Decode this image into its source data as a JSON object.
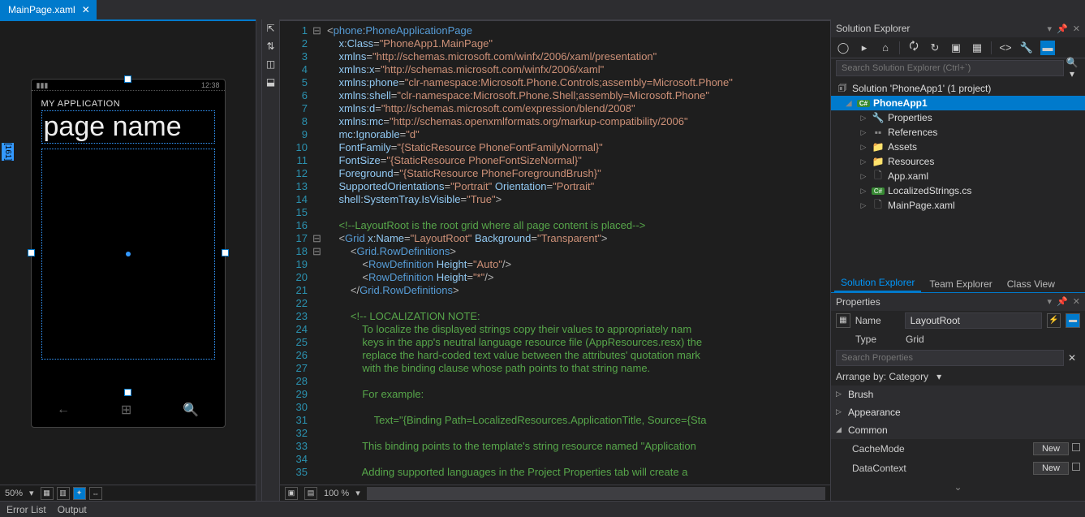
{
  "tab": {
    "title": "MainPage.xaml",
    "close": "✕"
  },
  "designer": {
    "phone_time": "12:38",
    "app_title": "MY APPLICATION",
    "page_title": "page name",
    "zoom": "50%",
    "ruler_tag": "[161]"
  },
  "editor": {
    "zoom": "100 %",
    "lines": [
      {
        "n": 1,
        "fold": "⊟",
        "html": "<span class='punct'>&lt;</span><span class='xml-el'>phone</span><span class='punct'>:</span><span class='xml-el'>PhoneApplicationPage</span>"
      },
      {
        "n": 2,
        "html": "    <span class='xml-attr'>x</span><span class='punct'>:</span><span class='xml-attr'>Class</span><span class='punct'>=</span><span class='str'>\"PhoneApp1.MainPage\"</span>"
      },
      {
        "n": 3,
        "html": "    <span class='xml-attr'>xmlns</span><span class='punct'>=</span><span class='str'>\"http://schemas.microsoft.com/winfx/2006/xaml/presentation\"</span>"
      },
      {
        "n": 4,
        "html": "    <span class='xml-attr'>xmlns</span><span class='punct'>:</span><span class='xml-attr'>x</span><span class='punct'>=</span><span class='str'>\"http://schemas.microsoft.com/winfx/2006/xaml\"</span>"
      },
      {
        "n": 5,
        "html": "    <span class='xml-attr'>xmlns</span><span class='punct'>:</span><span class='xml-attr'>phone</span><span class='punct'>=</span><span class='str'>\"clr-namespace:Microsoft.Phone.Controls;assembly=Microsoft.Phone\"</span>"
      },
      {
        "n": 6,
        "html": "    <span class='xml-attr'>xmlns</span><span class='punct'>:</span><span class='xml-attr'>shell</span><span class='punct'>=</span><span class='str'>\"clr-namespace:Microsoft.Phone.Shell;assembly=Microsoft.Phone\"</span>"
      },
      {
        "n": 7,
        "html": "    <span class='xml-attr'>xmlns</span><span class='punct'>:</span><span class='xml-attr'>d</span><span class='punct'>=</span><span class='str'>\"http://schemas.microsoft.com/expression/blend/2008\"</span>"
      },
      {
        "n": 8,
        "html": "    <span class='xml-attr'>xmlns</span><span class='punct'>:</span><span class='xml-attr'>mc</span><span class='punct'>=</span><span class='str'>\"http://schemas.openxmlformats.org/markup-compatibility/2006\"</span>"
      },
      {
        "n": 9,
        "html": "    <span class='xml-attr'>mc</span><span class='punct'>:</span><span class='xml-attr'>Ignorable</span><span class='punct'>=</span><span class='str'>\"d\"</span>"
      },
      {
        "n": 10,
        "html": "    <span class='xml-attr'>FontFamily</span><span class='punct'>=</span><span class='str'>\"{StaticResource PhoneFontFamilyNormal}\"</span>"
      },
      {
        "n": 11,
        "html": "    <span class='xml-attr'>FontSize</span><span class='punct'>=</span><span class='str'>\"{StaticResource PhoneFontSizeNormal}\"</span>"
      },
      {
        "n": 12,
        "html": "    <span class='xml-attr'>Foreground</span><span class='punct'>=</span><span class='str'>\"{StaticResource PhoneForegroundBrush}\"</span>"
      },
      {
        "n": 13,
        "html": "    <span class='xml-attr'>SupportedOrientations</span><span class='punct'>=</span><span class='str'>\"Portrait\"</span> <span class='xml-attr'>Orientation</span><span class='punct'>=</span><span class='str'>\"Portrait\"</span>"
      },
      {
        "n": 14,
        "html": "    <span class='xml-attr'>shell</span><span class='punct'>:</span><span class='xml-attr'>SystemTray.IsVisible</span><span class='punct'>=</span><span class='str'>\"True\"</span><span class='punct'>&gt;</span>"
      },
      {
        "n": 15,
        "html": ""
      },
      {
        "n": 16,
        "html": "    <span class='cmt'>&lt;!--LayoutRoot is the root grid where all page content is placed--&gt;</span>"
      },
      {
        "n": 17,
        "fold": "⊟",
        "html": "    <span class='punct'>&lt;</span><span class='xml-el'>Grid</span> <span class='xml-attr'>x</span><span class='punct'>:</span><span class='xml-attr'>Name</span><span class='punct'>=</span><span class='str'>\"LayoutRoot\"</span> <span class='xml-attr'>Background</span><span class='punct'>=</span><span class='str'>\"Transparent\"</span><span class='punct'>&gt;</span>"
      },
      {
        "n": 18,
        "fold": "⊟",
        "html": "        <span class='punct'>&lt;</span><span class='xml-el'>Grid.RowDefinitions</span><span class='punct'>&gt;</span>"
      },
      {
        "n": 19,
        "html": "            <span class='punct'>&lt;</span><span class='xml-el'>RowDefinition</span> <span class='xml-attr'>Height</span><span class='punct'>=</span><span class='str'>\"Auto\"</span><span class='punct'>/&gt;</span>"
      },
      {
        "n": 20,
        "html": "            <span class='punct'>&lt;</span><span class='xml-el'>RowDefinition</span> <span class='xml-attr'>Height</span><span class='punct'>=</span><span class='str'>\"*\"</span><span class='punct'>/&gt;</span>"
      },
      {
        "n": 21,
        "html": "        <span class='punct'>&lt;/</span><span class='xml-el'>Grid.RowDefinitions</span><span class='punct'>&gt;</span>"
      },
      {
        "n": 22,
        "html": ""
      },
      {
        "n": 23,
        "html": "        <span class='cmt'>&lt;!-- LOCALIZATION NOTE:</span>"
      },
      {
        "n": 24,
        "html": "            <span class='cmt'>To localize the displayed strings copy their values to appropriately nam</span>"
      },
      {
        "n": 25,
        "html": "            <span class='cmt'>keys in the app's neutral language resource file (AppResources.resx) the</span>"
      },
      {
        "n": 26,
        "html": "            <span class='cmt'>replace the hard-coded text value between the attributes' quotation mark</span>"
      },
      {
        "n": 27,
        "html": "            <span class='cmt'>with the binding clause whose path points to that string name.</span>"
      },
      {
        "n": 28,
        "html": ""
      },
      {
        "n": 29,
        "html": "            <span class='cmt'>For example:</span>"
      },
      {
        "n": 30,
        "html": ""
      },
      {
        "n": 31,
        "html": "                <span class='cmt'>Text=\"{Binding Path=LocalizedResources.ApplicationTitle, Source={Sta</span>"
      },
      {
        "n": 32,
        "html": ""
      },
      {
        "n": 33,
        "html": "            <span class='cmt'>This binding points to the template's string resource named \"Application</span>"
      },
      {
        "n": 34,
        "html": ""
      },
      {
        "n": 35,
        "html": "            <span class='cmt'>Adding supported languages in the Project Properties tab will create a </span>"
      }
    ]
  },
  "solution_explorer": {
    "title": "Solution Explorer",
    "search_placeholder": "Search Solution Explorer (Ctrl+`)",
    "solution": "Solution 'PhoneApp1' (1 project)",
    "project": "PhoneApp1",
    "nodes": [
      {
        "label": "Properties",
        "icon": "wrench"
      },
      {
        "label": "References",
        "icon": "ref"
      },
      {
        "label": "Assets",
        "icon": "folder"
      },
      {
        "label": "Resources",
        "icon": "folder"
      },
      {
        "label": "App.xaml",
        "icon": "xaml"
      },
      {
        "label": "LocalizedStrings.cs",
        "icon": "cs"
      },
      {
        "label": "MainPage.xaml",
        "icon": "xaml"
      }
    ],
    "tabs": [
      "Solution Explorer",
      "Team Explorer",
      "Class View"
    ]
  },
  "properties": {
    "title": "Properties",
    "name_label": "Name",
    "name_value": "LayoutRoot",
    "type_label": "Type",
    "type_value": "Grid",
    "search_placeholder": "Search Properties",
    "arrange_label": "Arrange by: Category",
    "cats": [
      "Brush",
      "Appearance",
      "Common"
    ],
    "common_items": [
      {
        "label": "CacheMode",
        "btn": "New"
      },
      {
        "label": "DataContext",
        "btn": "New"
      }
    ]
  },
  "footer": {
    "error_list": "Error List",
    "output": "Output"
  }
}
